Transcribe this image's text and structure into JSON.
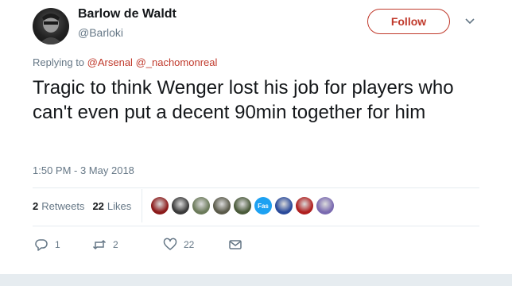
{
  "author": {
    "name": "Barlow de Waldt",
    "handle": "@Barloki"
  },
  "follow_label": "Follow",
  "reply": {
    "prefix": "Replying to ",
    "mentions": [
      "@Arsenal",
      "@_nachomonreal"
    ]
  },
  "tweet": {
    "text": "Tragic to think Wenger lost his job for players who can't even put a decent 90min together for him",
    "timestamp": "1:50 PM - 3 May 2018"
  },
  "stats": {
    "retweets_count": "2",
    "retweets_label": "Retweets",
    "likes_count": "22",
    "likes_label": "Likes"
  },
  "likers": [
    {
      "icon": "avatar-liker-1",
      "color": "#8b1a1a"
    },
    {
      "icon": "avatar-liker-2",
      "color": "#3a3a3a"
    },
    {
      "icon": "avatar-liker-3",
      "color": "#6b7a5a"
    },
    {
      "icon": "avatar-liker-4",
      "color": "#5a5a4a"
    },
    {
      "icon": "avatar-liker-5",
      "color": "#4a5a3a"
    },
    {
      "icon": "avatar-liker-6",
      "color": "#1da1f2",
      "text": "Fas"
    },
    {
      "icon": "avatar-liker-7",
      "color": "#2a4a9a"
    },
    {
      "icon": "avatar-liker-8",
      "color": "#b02020"
    },
    {
      "icon": "avatar-liker-9",
      "color": "#7a6ab0"
    }
  ],
  "actions": {
    "replies": "1",
    "retweets": "2",
    "likes": "22"
  },
  "colors": {
    "accent": "#c0392b",
    "muted": "#657786",
    "text": "#14171a"
  }
}
